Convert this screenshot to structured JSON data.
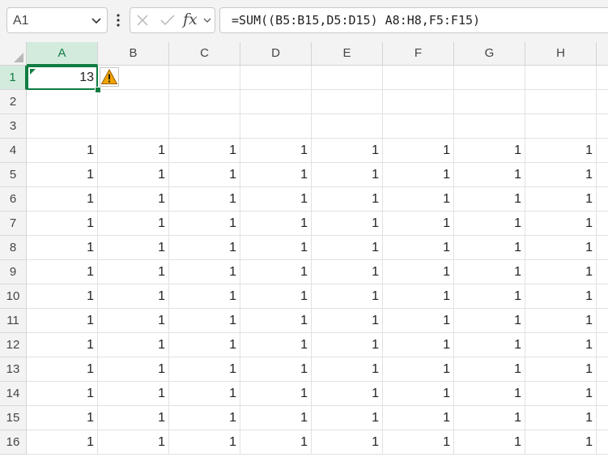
{
  "formula_bar": {
    "name_box": "A1",
    "fx_label": "fx",
    "formula": "=SUM((B5:B15,D5:D15) A8:H8,F5:F15)"
  },
  "columns": [
    "A",
    "B",
    "C",
    "D",
    "E",
    "F",
    "G",
    "H"
  ],
  "rows": [
    "1",
    "2",
    "3",
    "4",
    "5",
    "6",
    "7",
    "8",
    "9",
    "10",
    "11",
    "12",
    "13",
    "14",
    "15",
    "16"
  ],
  "cells": {
    "A1": "13",
    "grid_rows_4_to_16_value": "1"
  },
  "icons": {
    "name_box_dropdown": "chevron-down-icon",
    "more": "vertical-dots-icon",
    "cancel": "cancel-x-icon",
    "enter": "checkmark-icon",
    "error_indicator": "warning-icon"
  },
  "colors": {
    "accent": "#107c41",
    "header_selected": "#d3ebdd",
    "warning": "#f0a400"
  }
}
